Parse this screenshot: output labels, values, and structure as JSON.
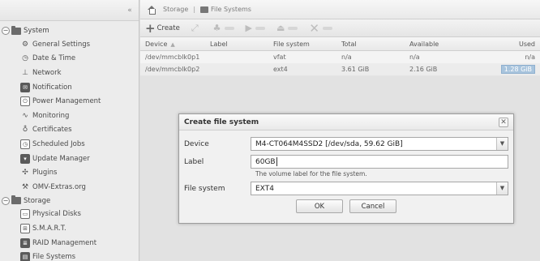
{
  "sidebar": {
    "collapse_icon": "double-chevron-left",
    "groups": [
      {
        "label": "System",
        "items": [
          {
            "label": "General Settings",
            "icon": "gear-icon"
          },
          {
            "label": "Date & Time",
            "icon": "clock-icon"
          },
          {
            "label": "Network",
            "icon": "network-icon"
          },
          {
            "label": "Notification",
            "icon": "mail-icon"
          },
          {
            "label": "Power Management",
            "icon": "power-icon"
          },
          {
            "label": "Monitoring",
            "icon": "chart-icon"
          },
          {
            "label": "Certificates",
            "icon": "certificate-icon"
          },
          {
            "label": "Scheduled Jobs",
            "icon": "clock-icon"
          },
          {
            "label": "Update Manager",
            "icon": "download-icon"
          },
          {
            "label": "Plugins",
            "icon": "puzzle-icon"
          },
          {
            "label": "OMV-Extras.org",
            "icon": "wrench-icon"
          }
        ]
      },
      {
        "label": "Storage",
        "items": [
          {
            "label": "Physical Disks",
            "icon": "disk-icon"
          },
          {
            "label": "S.M.A.R.T.",
            "icon": "smart-icon"
          },
          {
            "label": "RAID Management",
            "icon": "raid-icon"
          },
          {
            "label": "File Systems",
            "icon": "filesystem-icon"
          }
        ]
      }
    ]
  },
  "breadcrumb": {
    "items": [
      "Storage",
      "File Systems"
    ]
  },
  "toolbar": {
    "create_label": "Create"
  },
  "grid": {
    "columns": [
      "Device",
      "Label",
      "File system",
      "Total",
      "Available",
      "Used"
    ],
    "rows": [
      {
        "device": "/dev/mmcblk0p1",
        "label": "",
        "fs": "vfat",
        "total": "n/a",
        "available": "n/a",
        "used": "n/a"
      },
      {
        "device": "/dev/mmcblk0p2",
        "label": "",
        "fs": "ext4",
        "total": "3.61 GiB",
        "available": "2.16 GiB",
        "used": "1.28 GiB"
      }
    ]
  },
  "dialog": {
    "title": "Create file system",
    "device_label": "Device",
    "device_value": "M4-CT064M4SSD2 [/dev/sda, 59.62 GiB]",
    "label_label": "Label",
    "label_value": "60GB",
    "label_hint": "The volume label for the file system.",
    "fs_label": "File system",
    "fs_value": "EXT4",
    "ok_label": "OK",
    "cancel_label": "Cancel"
  }
}
